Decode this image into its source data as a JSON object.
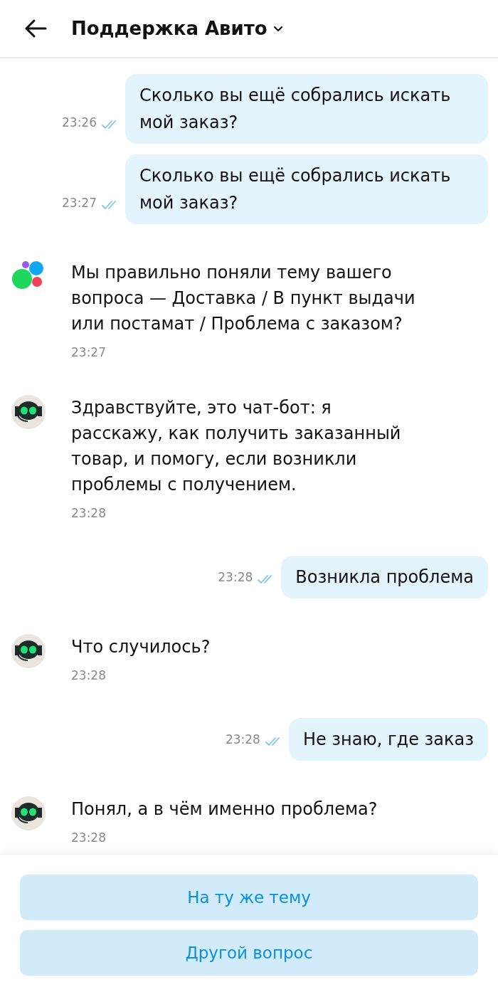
{
  "header": {
    "title": "Поддержка Авито"
  },
  "messages": [
    {
      "kind": "outgoing",
      "text": "Сколько вы ещё собрались искать мой заказ?",
      "time": "23:26",
      "read": true
    },
    {
      "kind": "outgoing",
      "text": "Сколько вы ещё собрались искать мой заказ?",
      "time": "23:27",
      "read": true
    },
    {
      "kind": "incoming",
      "avatar": {
        "kind": "logo"
      },
      "text": "Мы правильно поняли тему вашего вопроса — Доставка / В пункт выдачи или постамат / Проблема с заказом?",
      "time": "23:27"
    },
    {
      "kind": "incoming",
      "avatar": {
        "kind": "bot"
      },
      "text": "Здравствуйте, это чат-бот: я расскажу, как получить заказанный товар, и помогу, если возникли проблемы с получением.",
      "time": "23:28"
    },
    {
      "kind": "outgoing",
      "text": "Возникла проблема",
      "time": "23:28",
      "read": true
    },
    {
      "kind": "incoming",
      "avatar": {
        "kind": "bot"
      },
      "text": "Что случилось?",
      "time": "23:28"
    },
    {
      "kind": "outgoing",
      "text": "Не знаю, где заказ",
      "time": "23:28",
      "read": true
    },
    {
      "kind": "incoming",
      "avatar": {
        "kind": "bot"
      },
      "text": "Понял, а в чём именно проблема?",
      "time": "23:28"
    }
  ],
  "quick_replies": [
    "На ту же тему",
    "Другой вопрос"
  ]
}
